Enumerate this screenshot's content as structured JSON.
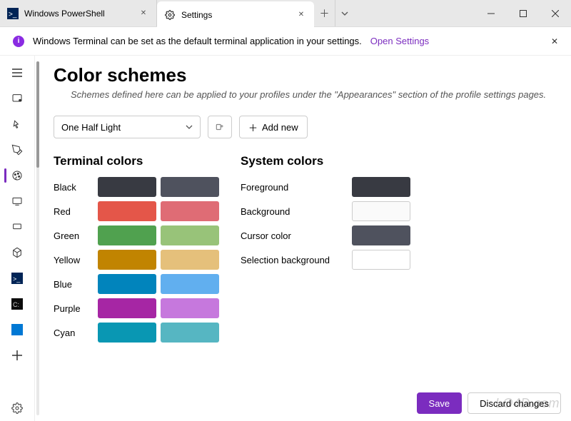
{
  "tabs": [
    {
      "title": "Windows PowerShell"
    },
    {
      "title": "Settings"
    }
  ],
  "infobar": {
    "message": "Windows Terminal can be set as the default terminal application in your settings.",
    "link": "Open Settings"
  },
  "page": {
    "title": "Color schemes",
    "subtitle": "Schemes defined here can be applied to your profiles under the \"Appearances\" section of the profile settings pages."
  },
  "toolbar": {
    "selected_scheme": "One Half Light",
    "add_label": "Add new"
  },
  "sections": {
    "terminal": "Terminal colors",
    "system": "System colors"
  },
  "terminal_colors": [
    {
      "name": "Black",
      "c1": "#383A42",
      "c2": "#4F525E"
    },
    {
      "name": "Red",
      "c1": "#E45649",
      "c2": "#DF6C75"
    },
    {
      "name": "Green",
      "c1": "#50A14F",
      "c2": "#98C379"
    },
    {
      "name": "Yellow",
      "c1": "#C18401",
      "c2": "#E5C07B"
    },
    {
      "name": "Blue",
      "c1": "#0184BC",
      "c2": "#61AFEF"
    },
    {
      "name": "Purple",
      "c1": "#A626A4",
      "c2": "#C678DD"
    },
    {
      "name": "Cyan",
      "c1": "#0997B3",
      "c2": "#56B6C2"
    }
  ],
  "system_colors": [
    {
      "name": "Foreground",
      "c": "#383A42",
      "bordered": false
    },
    {
      "name": "Background",
      "c": "#FAFAFA",
      "bordered": true
    },
    {
      "name": "Cursor color",
      "c": "#4F525E",
      "bordered": false
    },
    {
      "name": "Selection background",
      "c": "#FFFFFF",
      "bordered": true
    }
  ],
  "footer": {
    "save": "Save",
    "discard": "Discard changes"
  },
  "watermark": "LO4D.com"
}
